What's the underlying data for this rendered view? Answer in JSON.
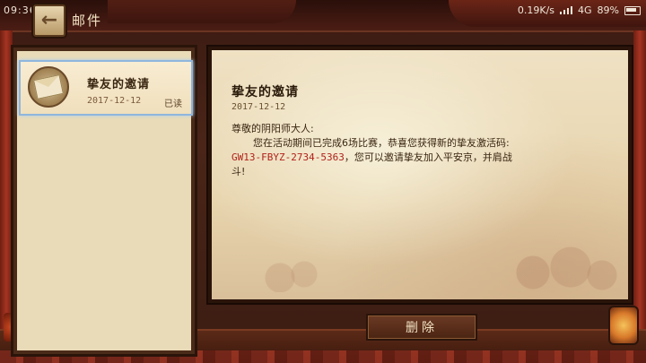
{
  "status_bar": {
    "time": "09:36",
    "network_speed": "0.19K/s",
    "signal_label": "4G",
    "battery": "89%"
  },
  "header": {
    "title": "邮件"
  },
  "mail_list": [
    {
      "title": "挚友的邀请",
      "date": "2017-12-12",
      "status": "已读"
    }
  ],
  "letter": {
    "title": "挚友的邀请",
    "date": "2017-12-12",
    "greeting": "尊敬的阴阳师大人:",
    "line1": "您在活动期间已完成6场比赛，恭喜您获得新的挚友激活码:",
    "code": "GW13-FBYZ-2734-5363",
    "line2_after_code": "，您可以邀请挚友加入平安京，并肩战",
    "line3": "斗!"
  },
  "actions": {
    "delete_label": "删除"
  }
}
